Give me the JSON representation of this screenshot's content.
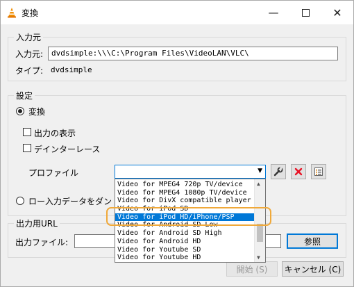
{
  "window": {
    "title": "変換",
    "min_icon": "minimize-icon",
    "max_icon": "maximize-icon",
    "close_icon": "close-icon"
  },
  "source": {
    "group_label": "入力元",
    "field_label": "入力元:",
    "value": "dvdsimple:\\\\\\C:\\Program Files\\VideoLAN\\VLC\\",
    "type_label": "タイプ:",
    "type_value": "dvdsimple"
  },
  "settings": {
    "group_label": "設定",
    "convert_label": "変換",
    "show_output_label": "出力の表示",
    "deinterlace_label": "デインターレース",
    "profile_label": "プロファイル",
    "dump_label": "ロー入力データをダン",
    "profile_options": [
      "Video for MPEG4 720p TV/device",
      "Video for MPEG4 1080p TV/device",
      "Video for DivX compatible player",
      "Video for iPod SD",
      "Video for iPod HD/iPhone/PSP",
      "Video for Android SD Low",
      "Video for Android SD High",
      "Video for Android HD",
      "Video for Youtube SD",
      "Video for Youtube HD"
    ],
    "selected_index": 4
  },
  "destination": {
    "group_label": "出力用URL",
    "file_label": "出力ファイル:",
    "browse_label": "参照"
  },
  "footer": {
    "start_label": "開始 (S)",
    "cancel_label": "キャンセル (C)"
  },
  "colors": {
    "accent": "#0078d7",
    "highlight": "#f0a93a",
    "delete": "#e81123"
  }
}
